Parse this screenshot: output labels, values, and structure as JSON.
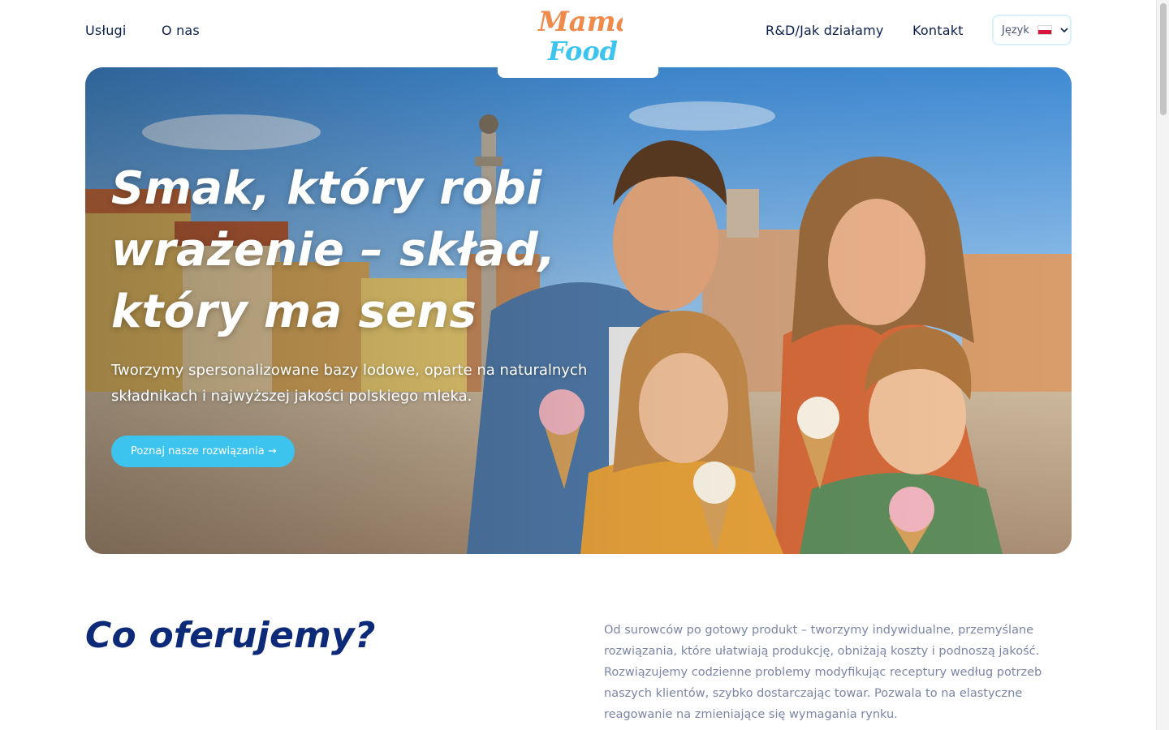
{
  "nav": {
    "left": [
      "Usługi",
      "O nas"
    ],
    "right": [
      "R&D/Jak działamy",
      "Kontakt"
    ],
    "language_label": "Język",
    "language_flag": "poland-flag-icon"
  },
  "logo": {
    "line1": "Mama",
    "line2": "Food",
    "color1": "#f08a4b",
    "color2": "#3cc4ef"
  },
  "hero": {
    "title": "Smak, który robi wrażenie – skład, który ma sens",
    "subtitle": "Tworzymy spersonalizowane bazy lodowe, oparte na naturalnych składnikach i najwyższej jakości polskiego mleka.",
    "button_label": "Poznaj nasze rozwiązania →",
    "accent": "#3cc4ef"
  },
  "offer": {
    "title": "Co oferujemy?",
    "text": "Od surowców po gotowy produkt – tworzymy indywidualne, przemyślane rozwiązania, które ułatwiają produkcję, obniżają koszty i podnoszą jakość. Rozwiązujemy codzienne problemy modyfikując receptury według potrzeb naszych klientów, szybko dostarczając towar. Pozwala to na elastyczne reagowanie na zmieniające się wymagania rynku."
  }
}
